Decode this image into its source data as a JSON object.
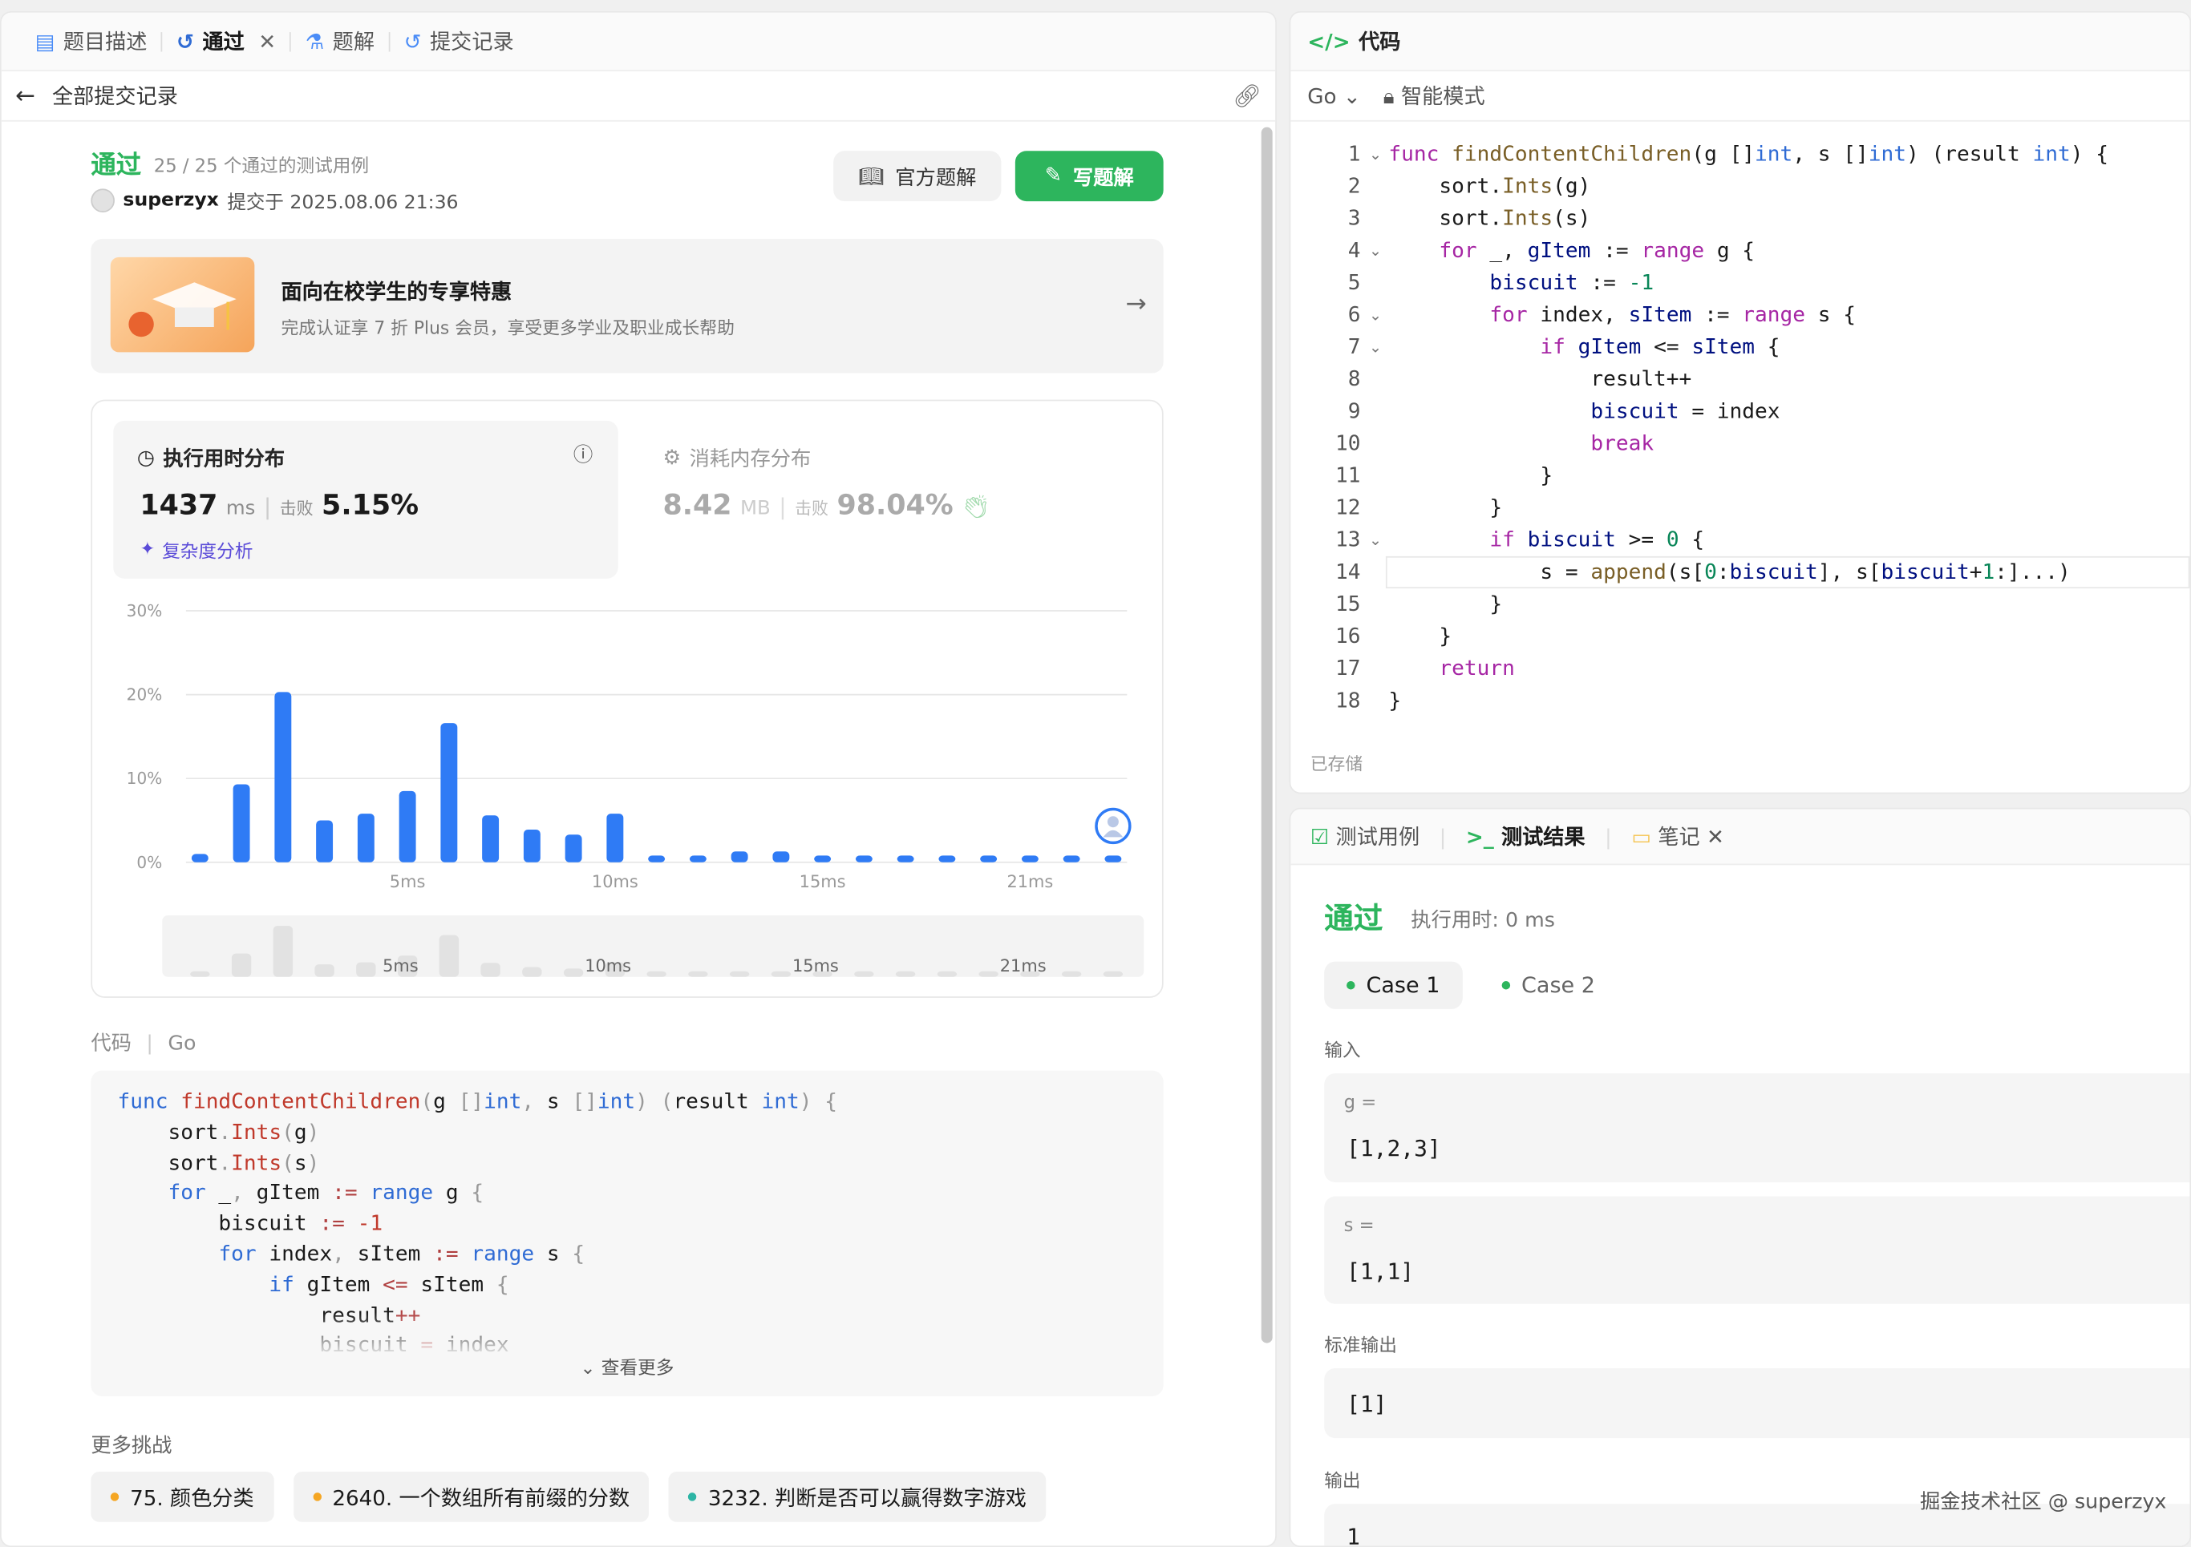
{
  "left_tabs": [
    {
      "label": "题目描述"
    },
    {
      "label": "通过"
    },
    {
      "label": "题解"
    },
    {
      "label": "提交记录"
    }
  ],
  "subbar": {
    "back_label": "全部提交记录"
  },
  "submission": {
    "status": "通过",
    "cases": "25 / 25 个通过的测试用例",
    "user": "superzyx",
    "submitted_at": "提交于 2025.08.06 21:36"
  },
  "buttons": {
    "official": "官方题解",
    "write": "写题解"
  },
  "promo": {
    "title": "面向在校学生的专享特惠",
    "desc": "完成认证享 7 折 Plus 会员，享受更多学业及职业成长帮助"
  },
  "runtime": {
    "title": "执行用时分布",
    "value": "1437",
    "unit": "ms",
    "beat_label": "击败",
    "beat": "5.15%",
    "complexity": "复杂度分析"
  },
  "memory": {
    "title": "消耗内存分布",
    "value": "8.42",
    "unit": "MB",
    "beat_label": "击败",
    "beat": "98.04%"
  },
  "chart_data": {
    "type": "bar",
    "title": "",
    "xlabel": "",
    "ylabel": "",
    "y_ticks": [
      "30%",
      "20%",
      "10%",
      "0%"
    ],
    "x_ticks": [
      "5ms",
      "10ms",
      "15ms",
      "21ms"
    ],
    "ylim": [
      0,
      30
    ],
    "values": [
      1,
      9.3,
      20.3,
      5,
      5.8,
      8.5,
      16.6,
      5.6,
      3.9,
      3.3,
      5.8,
      0.8,
      0.8,
      1.3,
      1.3,
      0.8,
      0.8,
      0.8,
      0.8,
      0.8,
      0.8,
      0.8,
      0.8
    ],
    "color": "#2f7bf5",
    "grid": true
  },
  "code_section": {
    "label": "代码",
    "lang": "Go",
    "more": "查看更多"
  },
  "more_challenges": {
    "title": "更多挑战",
    "items": [
      {
        "label": "75. 颜色分类",
        "color": "#f5a623"
      },
      {
        "label": "2640. 一个数组所有前缀的分数",
        "color": "#f5a623"
      },
      {
        "label": "3232. 判断是否可以赢得数字游戏",
        "color": "#2db5a5"
      }
    ]
  },
  "editor": {
    "title": "代码",
    "lang": "Go",
    "mode": "智能模式",
    "saved": "已存储",
    "lines": [
      "func findContentChildren(g []int, s []int) (result int) {",
      "    sort.Ints(g)",
      "    sort.Ints(s)",
      "    for _, gItem := range g {",
      "        biscuit := -1",
      "        for index, sItem := range s {",
      "            if gItem <= sItem {",
      "                result++",
      "                biscuit = index",
      "                break",
      "            }",
      "        }",
      "        if biscuit >= 0 {",
      "            s = append(s[0:biscuit], s[biscuit+1:]...)",
      "        }",
      "    }",
      "    return",
      "}"
    ]
  },
  "result_tabs": {
    "testcase": "测试用例",
    "result": "测试结果",
    "note": "笔记"
  },
  "result": {
    "status": "通过",
    "time": "执行用时: 0 ms",
    "cases": [
      "Case 1",
      "Case 2"
    ],
    "input_label": "输入",
    "g_key": "g =",
    "g_val": "[1,2,3]",
    "s_key": "s =",
    "s_val": "[1,1]",
    "stdout_label": "标准输出",
    "stdout_val": "[1]",
    "output_label": "输出",
    "output_val": "1"
  },
  "watermark": "掘金技术社区 @ superzyx"
}
